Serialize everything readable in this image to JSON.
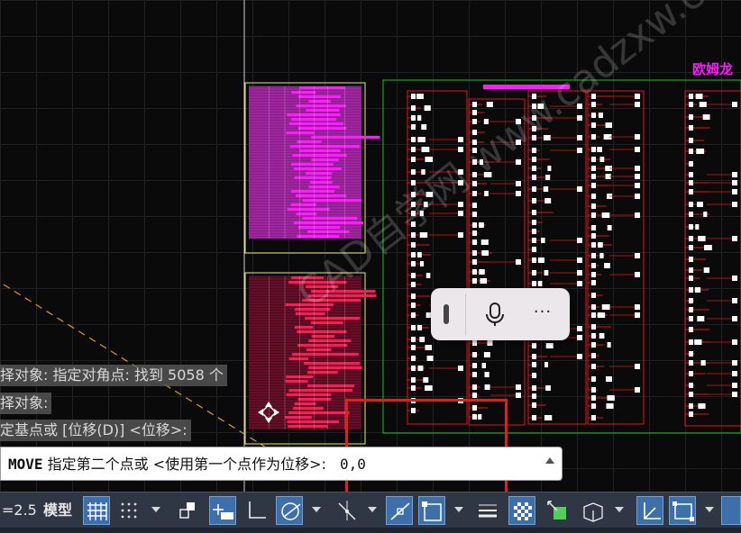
{
  "command_history": [
    "择对象: 指定对角点: 找到 5058 个",
    "择对象:",
    "定基点或 [位移(D)] <位移>:"
  ],
  "command_line": {
    "prompt_prefix": "MOVE",
    "prompt_text": "指定第二个点或 <使用第一个点作为位移>:",
    "value": "0,0"
  },
  "drawing": {
    "title_text": "欧姆龙",
    "watermark": "CAD自学网 www.cadzxw.com"
  },
  "voice_toolbar": {
    "more_label": "···",
    "icons": [
      "drag-handle-icon",
      "microphone-icon",
      "more-icon"
    ]
  },
  "status_bar": {
    "scale_text": "=2.5",
    "model_label": "模型",
    "buttons": [
      "grid-icon",
      "snap-icon",
      "infer-constraints-icon",
      "dynamic-input-icon",
      "ortho-icon",
      "polar-icon",
      "isodraft-icon",
      "object-snap-tracking-icon",
      "object-snap-icon",
      "lineweight-icon",
      "transparency-icon",
      "selection-cycling-icon",
      "3d-object-snap-icon",
      "dynamic-ucs-icon",
      "selection-filter-icon"
    ]
  },
  "colors": {
    "canvas": "#0a0a0a",
    "drawing_red": "#e0141e",
    "magenta": "#ff1aff",
    "border_green": "#19c419",
    "frame_yellow": "#e8e87a",
    "status_bg": "#2f3744",
    "active_button": "#3d6fa8"
  }
}
